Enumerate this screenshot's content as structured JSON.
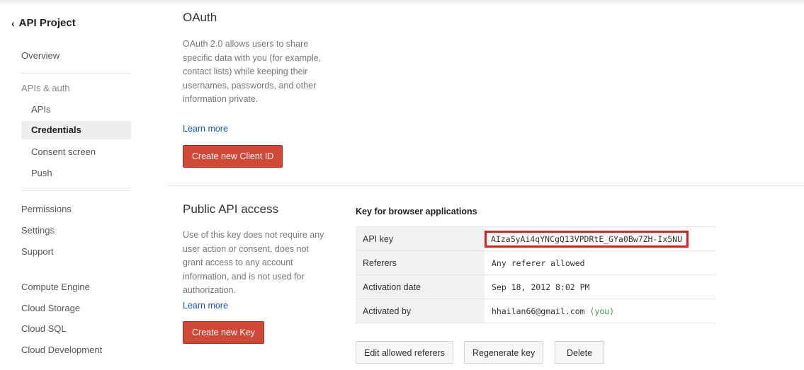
{
  "sidebar": {
    "back_label": "API Project",
    "items": {
      "overview": "Overview",
      "apis_auth": "APIs & auth",
      "apis": "APIs",
      "credentials": "Credentials",
      "consent": "Consent screen",
      "push": "Push",
      "permissions": "Permissions",
      "settings": "Settings",
      "support": "Support",
      "compute": "Compute Engine",
      "storage": "Cloud Storage",
      "sql": "Cloud SQL",
      "development": "Cloud Development"
    }
  },
  "oauth": {
    "title": "OAuth",
    "description": "OAuth 2.0 allows users to share specific data with you (for example, contact lists) while keeping their usernames, passwords, and other information private.",
    "learn_more": "Learn more",
    "button": "Create new Client ID"
  },
  "public_api": {
    "title": "Public API access",
    "description": "Use of this key does not require any user action or consent, does not grant access to any account information, and is not used for authorization.",
    "learn_more": "Learn more",
    "button": "Create new Key",
    "key_heading": "Key for browser applications",
    "rows": {
      "api_key_label": "API key",
      "api_key_value": "AIzaSyAi4qYNCgQ13VPDRtE_GYa0Bw7ZH-Ix5NU",
      "referers_label": "Referers",
      "referers_value": "Any referer allowed",
      "activation_label": "Activation date",
      "activation_value": "Sep 18, 2012 8:02 PM",
      "activated_by_label": "Activated by",
      "activated_by_value": "hhailan66@gmail.com",
      "activated_by_you": "(you)"
    },
    "actions": {
      "edit": "Edit allowed referers",
      "regenerate": "Regenerate key",
      "delete": "Delete"
    }
  },
  "colors": {
    "accent_red": "#d14836",
    "highlight_box": "#e0201e",
    "link": "#1155cc"
  }
}
